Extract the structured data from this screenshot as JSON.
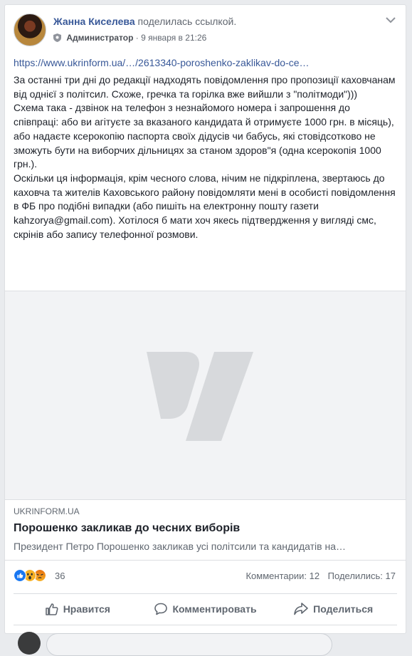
{
  "post": {
    "author": "Жанна Киселева",
    "action_text": "поделилась ссылкой.",
    "role": "Администратор",
    "separator": "·",
    "timestamp": "9 января в 21:26",
    "link_url": "https://www.ukrinform.ua/…/2613340-poroshenko-zaklikav-do-ce…",
    "text": "За останні три дні до редакції надходять повідомлення про пропозиції каховчанам від однієї з політсил. Схоже, гречка та горілка вже вийшли з \"політмоди\")))\nСхема така - дзвінок на телефон з незнайомого номера і запрошення до співпраці: або ви агітуєте за вказаного кандидата й отримуєте 1000 грн. в місяць), або надаєте ксерокопію паспорта своїх дідусів чи бабусь, які стовідсотково не зможуть бути на виборчих дільницях за станом здоров\"я (одна ксерокопія 1000 грн.).\nОскільки ця інформація, крім чесного слова, нічим не підкріплена, звертаюсь до каховча та жителів Каховського району повідомляти мені в особисті повідомлення в ФБ про подібні випадки (або пишіть на електронну пошту газети kahzorya@gmail.com). Хотілося б мати хоч якесь підтвердження у вигляді смс, скрінів або запису телефонної розмови."
  },
  "preview": {
    "domain": "UKRINFORM.UA",
    "title": "Порошенко закликав до чесних виборів",
    "description": "Президент Петро Порошенко закликав усі політсили та кандидатів на…"
  },
  "stats": {
    "reaction_count": "36",
    "comments": "Комментарии: 12",
    "shares": "Поделились: 17"
  },
  "actions": {
    "like": "Нравится",
    "comment": "Комментировать",
    "share": "Поделиться"
  },
  "icons": {
    "reaction_like": "like-reaction-icon",
    "reaction_wow": "wow-reaction-icon",
    "reaction_angry": "angry-reaction-icon"
  },
  "colors": {
    "link": "#385898",
    "muted": "#606770",
    "like_blue": "#1877f2",
    "wow_yellow": "#f7b125",
    "angry_orange": "#e9710f"
  }
}
